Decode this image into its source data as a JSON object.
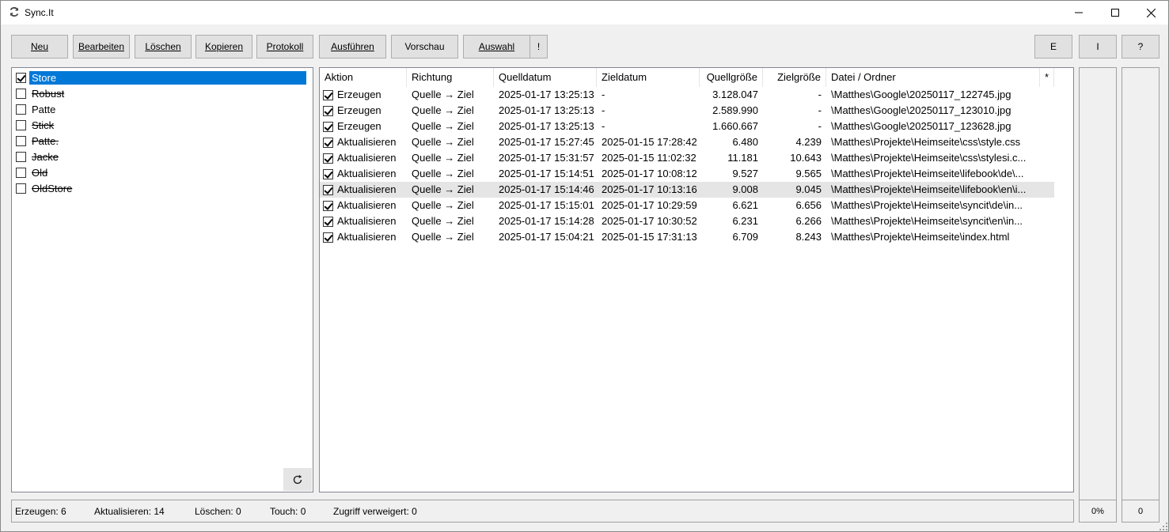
{
  "window": {
    "title": "Sync.It"
  },
  "toolbar": {
    "new": "Neu",
    "edit": "Bearbeiten",
    "delete": "Löschen",
    "copy": "Kopieren",
    "log": "Protokoll",
    "run": "Ausführen",
    "preview": "Vorschau",
    "select": "Auswahl",
    "excl": "!",
    "e": "E",
    "i": "I",
    "help": "?"
  },
  "profiles": [
    {
      "label": "Store",
      "checked": true,
      "selected": true,
      "strike": false
    },
    {
      "label": "Robust",
      "checked": false,
      "selected": false,
      "strike": true
    },
    {
      "label": "Patte",
      "checked": false,
      "selected": false,
      "strike": false
    },
    {
      "label": "Stick",
      "checked": false,
      "selected": false,
      "strike": true
    },
    {
      "label": "Patte.",
      "checked": false,
      "selected": false,
      "strike": true
    },
    {
      "label": "Jacke",
      "checked": false,
      "selected": false,
      "strike": true
    },
    {
      "label": "Old",
      "checked": false,
      "selected": false,
      "strike": true
    },
    {
      "label": "OldStore",
      "checked": false,
      "selected": false,
      "strike": true
    }
  ],
  "table": {
    "columns": [
      "Aktion",
      "Richtung",
      "Quelldatum",
      "Zieldatum",
      "Quellgröße",
      "Zielgröße",
      "Datei / Ordner",
      "*"
    ],
    "rows": [
      {
        "checked": true,
        "action": "Erzeugen",
        "direction": "Quelle → Ziel",
        "src_date": "2025-01-17 13:25:13",
        "dst_date": "-",
        "src_size": "3.128.047",
        "dst_size": "-",
        "path": "\\Matthes\\Google\\20250117_122745.jpg",
        "highlight": false
      },
      {
        "checked": true,
        "action": "Erzeugen",
        "direction": "Quelle → Ziel",
        "src_date": "2025-01-17 13:25:13",
        "dst_date": "-",
        "src_size": "2.589.990",
        "dst_size": "-",
        "path": "\\Matthes\\Google\\20250117_123010.jpg",
        "highlight": false
      },
      {
        "checked": true,
        "action": "Erzeugen",
        "direction": "Quelle → Ziel",
        "src_date": "2025-01-17 13:25:13",
        "dst_date": "-",
        "src_size": "1.660.667",
        "dst_size": "-",
        "path": "\\Matthes\\Google\\20250117_123628.jpg",
        "highlight": false
      },
      {
        "checked": true,
        "action": "Aktualisieren",
        "direction": "Quelle → Ziel",
        "src_date": "2025-01-17 15:27:45",
        "dst_date": "2025-01-15 17:28:42",
        "src_size": "6.480",
        "dst_size": "4.239",
        "path": "\\Matthes\\Projekte\\Heimseite\\css\\style.css",
        "highlight": false
      },
      {
        "checked": true,
        "action": "Aktualisieren",
        "direction": "Quelle → Ziel",
        "src_date": "2025-01-17 15:31:57",
        "dst_date": "2025-01-15 11:02:32",
        "src_size": "11.181",
        "dst_size": "10.643",
        "path": "\\Matthes\\Projekte\\Heimseite\\css\\stylesi.c...",
        "highlight": false
      },
      {
        "checked": true,
        "action": "Aktualisieren",
        "direction": "Quelle → Ziel",
        "src_date": "2025-01-17 15:14:51",
        "dst_date": "2025-01-17 10:08:12",
        "src_size": "9.527",
        "dst_size": "9.565",
        "path": "\\Matthes\\Projekte\\Heimseite\\lifebook\\de\\...",
        "highlight": false
      },
      {
        "checked": true,
        "action": "Aktualisieren",
        "direction": "Quelle → Ziel",
        "src_date": "2025-01-17 15:14:46",
        "dst_date": "2025-01-17 10:13:16",
        "src_size": "9.008",
        "dst_size": "9.045",
        "path": "\\Matthes\\Projekte\\Heimseite\\lifebook\\en\\i...",
        "highlight": true
      },
      {
        "checked": true,
        "action": "Aktualisieren",
        "direction": "Quelle → Ziel",
        "src_date": "2025-01-17 15:15:01",
        "dst_date": "2025-01-17 10:29:59",
        "src_size": "6.621",
        "dst_size": "6.656",
        "path": "\\Matthes\\Projekte\\Heimseite\\syncit\\de\\in...",
        "highlight": false
      },
      {
        "checked": true,
        "action": "Aktualisieren",
        "direction": "Quelle → Ziel",
        "src_date": "2025-01-17 15:14:28",
        "dst_date": "2025-01-17 10:30:52",
        "src_size": "6.231",
        "dst_size": "6.266",
        "path": "\\Matthes\\Projekte\\Heimseite\\syncit\\en\\in...",
        "highlight": false
      },
      {
        "checked": true,
        "action": "Aktualisieren",
        "direction": "Quelle → Ziel",
        "src_date": "2025-01-17 15:04:21",
        "dst_date": "2025-01-15 17:31:13",
        "src_size": "6.709",
        "dst_size": "8.243",
        "path": "\\Matthes\\Projekte\\Heimseite\\index.html",
        "highlight": false
      }
    ]
  },
  "status": {
    "create": "Erzeugen: 6",
    "update": "Aktualisieren: 14",
    "delete": "Löschen: 0",
    "touch": "Touch: 0",
    "denied": "Zugriff verweigert: 0",
    "percent": "0%",
    "count": "0"
  },
  "icons": {
    "app": "sync-icon",
    "minimize": "minimize-icon",
    "maximize": "maximize-icon",
    "close": "close-icon",
    "refresh": "refresh-icon"
  },
  "colors": {
    "selection": "#0078d7",
    "row_highlight": "#e5e5e5"
  }
}
